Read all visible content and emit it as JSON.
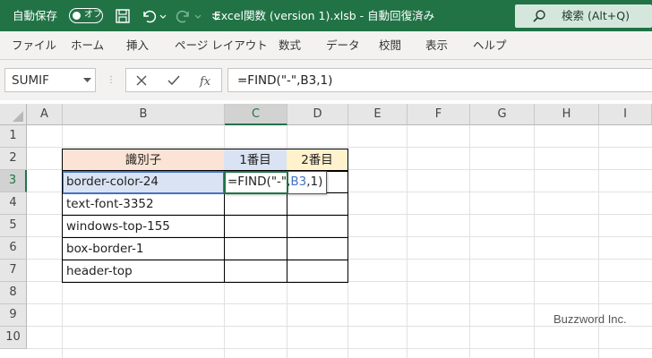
{
  "titlebar": {
    "autosave_label": "自動保存",
    "autosave_state": "オフ",
    "document_title": "Excel関数 (version 1).xlsb  -  自動回復済み",
    "search_label": "検索 (Alt+Q)",
    "bg_color": "#217346"
  },
  "ribbon": {
    "tabs": [
      "ファイル",
      "ホーム",
      "挿入",
      "ページ レイアウト",
      "数式",
      "データ",
      "校閲",
      "表示",
      "ヘルプ"
    ]
  },
  "formula_bar": {
    "name_box": "SUMIF",
    "formula": "=FIND(\"-\",B3,1)"
  },
  "grid": {
    "columns": [
      "A",
      "B",
      "C",
      "D",
      "E",
      "F",
      "G",
      "H",
      "I"
    ],
    "rows": [
      "1",
      "2",
      "3",
      "4",
      "5",
      "6",
      "7",
      "8",
      "9",
      "10"
    ],
    "active_column": "C",
    "active_row": "3",
    "header_row": {
      "b": "識別子",
      "c": "1番目",
      "d": "2番目"
    },
    "header_colors": {
      "b": "#fbe4d5",
      "c": "#dae3f3",
      "d": "#fff2cc"
    },
    "identifiers": [
      "border-color-24",
      "text-font-3352",
      "windows-top-155",
      "box-border-1",
      "header-top"
    ],
    "edit_cell": {
      "before": "=FIND(\"-\",",
      "ref": "B3",
      "after": ",1)"
    }
  },
  "watermark": "Buzzword Inc."
}
